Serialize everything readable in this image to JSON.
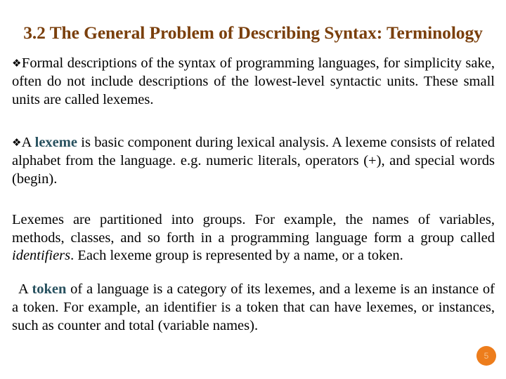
{
  "slide": {
    "title": "3.2 The General Problem of Describing Syntax: Terminology",
    "title_color": "#7A3F0C",
    "background_color": "#FFFFFF",
    "body_text_color": "#000000",
    "highlight_color": "#28515F",
    "page_number": "5",
    "page_badge_color": "#ED7D1C",
    "bullet_glyph": "❖",
    "paragraphs": [
      {
        "bulleted": true,
        "segments": [
          {
            "text": "Formal descriptions of the syntax of programming languages, for simplicity sake, often do not include descriptions of the lowest-level syntactic units. These small units are called lexemes.",
            "style": "normal"
          }
        ]
      },
      {
        "bulleted": true,
        "segments": [
          {
            "text": "A ",
            "style": "normal"
          },
          {
            "text": "lexeme",
            "style": "highlight-bold"
          },
          {
            "text": " is basic component during lexical analysis. A lexeme consists of related alphabet from the language. e.g. numeric literals, operators (+),  and special words (begin).",
            "style": "normal"
          }
        ]
      },
      {
        "bulleted": false,
        "segments": [
          {
            "text": "Lexemes are partitioned into groups. For example, the names of variables, methods, classes, and so forth in a programming language form a group called ",
            "style": "normal"
          },
          {
            "text": "identifiers",
            "style": "italic"
          },
          {
            "text": ". Each lexeme group is represented by a name, or a token.",
            "style": "normal"
          }
        ]
      },
      {
        "bulleted": false,
        "indent": true,
        "segments": [
          {
            "text": "A ",
            "style": "normal"
          },
          {
            "text": "token",
            "style": "highlight-bold"
          },
          {
            "text": " of a language is a category of its lexemes, and a lexeme is an instance of a token. For example, an identifier is a token that can have lexemes, or instances, such as counter and total (variable names).",
            "style": "normal"
          }
        ]
      }
    ]
  }
}
